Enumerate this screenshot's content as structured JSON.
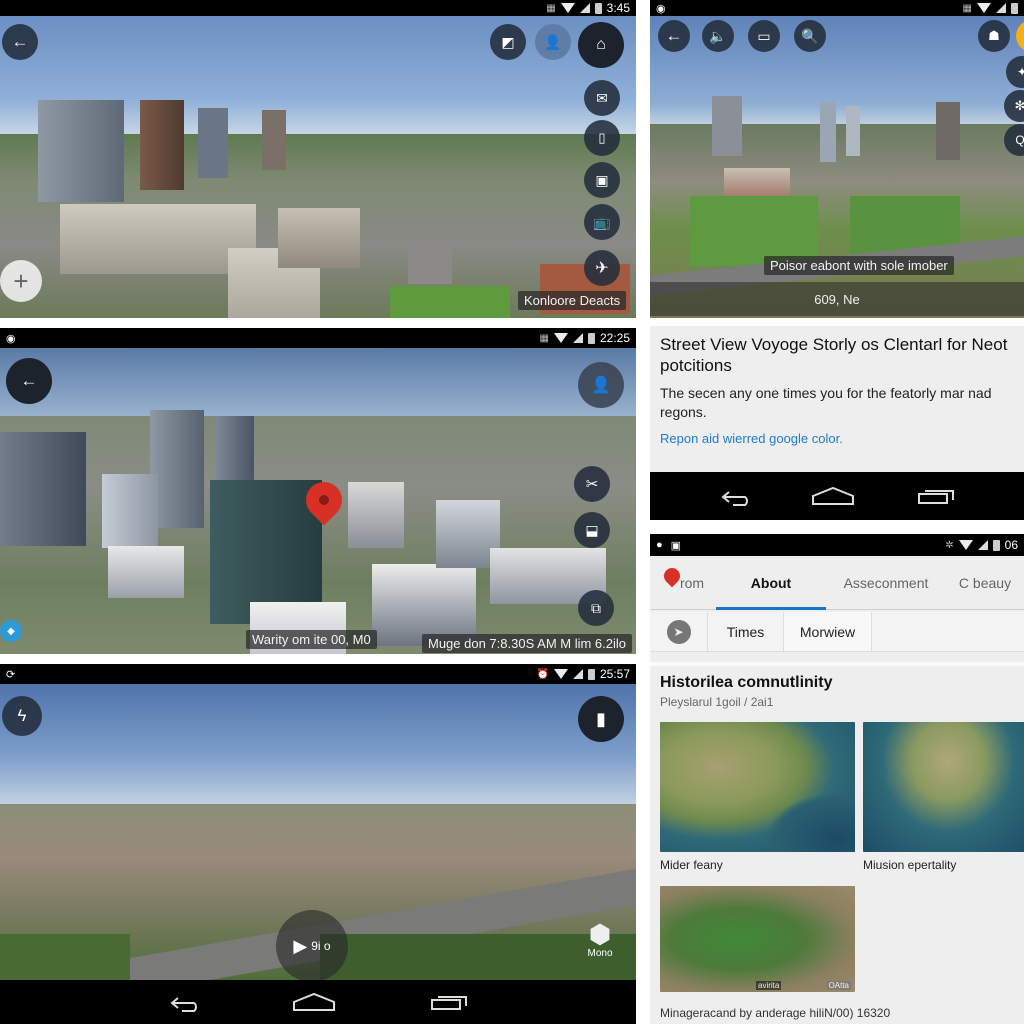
{
  "panel_top_left": {
    "status": {
      "time": "3:45"
    },
    "buttons": {
      "back": "back-arrow",
      "top_right": [
        "compass-icon",
        "profile-icon",
        "home-icon"
      ],
      "side": [
        "mail-icon",
        "bell-icon",
        "image-icon",
        "tv-icon",
        "plane-icon"
      ],
      "zoom": "plus-icon"
    },
    "label": "Konloore Deacts"
  },
  "panel_top_right": {
    "status": {
      "time": ""
    },
    "buttons": [
      "back-arrow",
      "speaker-icon",
      "cast-icon",
      "search-icon",
      "pegman-icon"
    ],
    "label": "Poisor eabont with sole imober",
    "sublabel": "609, Ne"
  },
  "article_card": {
    "title": "Street View Voyoge Storly os Clentarl for Neot potcitions",
    "body": "The secen any one times you for the featorly mar nad regons.",
    "link": "Repon aid wierred google color."
  },
  "panel_mid_left": {
    "status": {
      "time": "22:25"
    },
    "left_label": "Warity om ite 00, M0",
    "right_label": "Muge don 7:8.30S AM M lim 6.2ilo"
  },
  "panel_bottom_left": {
    "status": {
      "time": "25:57"
    },
    "play_label": "9i o",
    "cube_label": "Mono"
  },
  "info_panel": {
    "status": {
      "time": "06"
    },
    "tabs": [
      {
        "label": "rom",
        "active": false
      },
      {
        "label": "About",
        "active": true
      },
      {
        "label": "Asseconment",
        "active": false
      },
      {
        "label": "C beauy",
        "active": false
      }
    ],
    "subtabs": [
      "Times",
      "Morwiew"
    ],
    "section_title": "Historilea comnutlinity",
    "section_subtitle": "Pleyslarul 1goil / 2ai1",
    "thumbs": [
      {
        "caption": "Mider feany"
      },
      {
        "caption": "Miusion epertality"
      },
      {
        "caption": "",
        "badge_left": "avirita",
        "badge_right": "OAtta"
      }
    ],
    "footer": "Minageracand by anderage hiliN/00) 16320"
  },
  "colors": {
    "accent": "#1a73c8",
    "link": "#1e7bd0",
    "pin": "#d93025"
  }
}
